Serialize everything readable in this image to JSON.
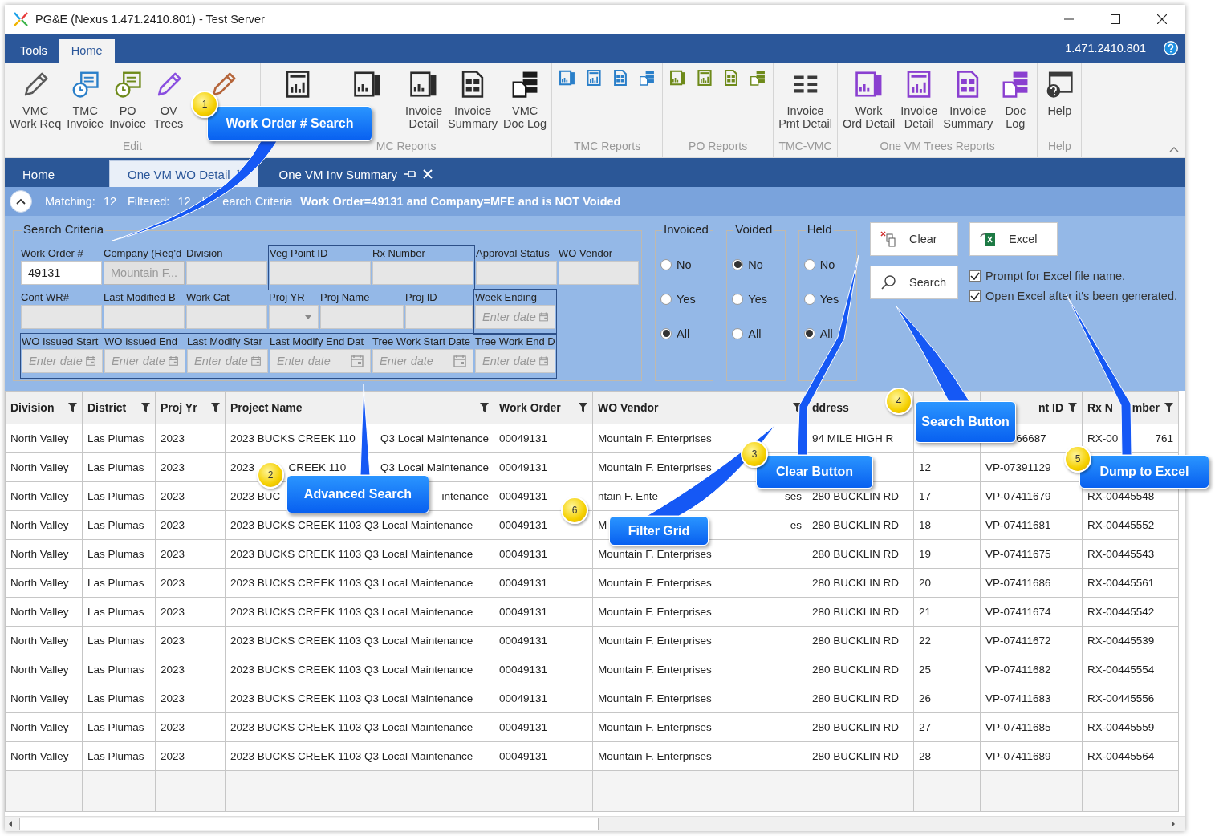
{
  "window": {
    "title": "PG&E (Nexus 1.471.2410.801) - Test Server"
  },
  "ribbon_tabs": [
    {
      "label": "Tools",
      "selected": false
    },
    {
      "label": "Home",
      "selected": true
    }
  ],
  "version": "1.471.2410.801",
  "ribbon_groups": [
    {
      "label": "Edit",
      "buttons": [
        {
          "kind": "pencil",
          "color": "#5a5a5a",
          "label": "VMC\nWork Req"
        },
        {
          "kind": "clock-doc",
          "color": "#2a7fc9",
          "label": "TMC\nInvoice"
        },
        {
          "kind": "clock-doc",
          "color": "#6e8a1a",
          "label": "PO\nInvoice"
        },
        {
          "kind": "pencil",
          "color": "#8a4fe0",
          "label": "OV\nTrees"
        },
        {
          "kind": "pencil",
          "color": "#b5653a"
        }
      ]
    },
    {
      "label": "MC Reports",
      "buttons": [
        {
          "kind": "report",
          "color": "#2b2b2b"
        },
        {
          "kind": "chart-doc",
          "color": "#2b2b2b"
        },
        {
          "kind": "chart-doc",
          "color": "#2b2b2b",
          "label": "Invoice\nDetail"
        },
        {
          "kind": "grid-doc",
          "color": "#2b2b2b",
          "label": "Invoice\nSummary"
        },
        {
          "kind": "doc-stack",
          "color": "#1a1a1a",
          "label": "VMC\nDoc Log"
        }
      ]
    },
    {
      "label": "TMC Reports",
      "buttons": [
        {
          "kind": "small-chart-doc",
          "color": "#2a7fc9"
        },
        {
          "kind": "small-report",
          "color": "#2a7fc9"
        },
        {
          "kind": "small-grid-doc",
          "color": "#2a7fc9"
        },
        {
          "kind": "small-doc-stack",
          "color": "#2a7fc9"
        }
      ]
    },
    {
      "label": "PO Reports",
      "buttons": [
        {
          "kind": "small-chart-doc",
          "color": "#6e8a1a"
        },
        {
          "kind": "small-report",
          "color": "#6e8a1a"
        },
        {
          "kind": "small-grid-doc",
          "color": "#6e8a1a"
        },
        {
          "kind": "small-doc-stack",
          "color": "#6e8a1a"
        }
      ]
    },
    {
      "label": "TMC-VMC",
      "buttons": [
        {
          "kind": "list",
          "color": "#3a3a3a",
          "label": "Invoice\nPmt Detail"
        }
      ]
    },
    {
      "label": "One VM Trees Reports",
      "buttons": [
        {
          "kind": "chart-doc",
          "color": "#8a3fd0",
          "label": "Work\nOrd Detail"
        },
        {
          "kind": "report",
          "color": "#8a3fd0",
          "label": "Invoice\nDetail"
        },
        {
          "kind": "grid-doc",
          "color": "#8a3fd0",
          "label": "Invoice\nSummary"
        },
        {
          "kind": "doc-stack",
          "color": "#8a3fd0",
          "label": "Doc\nLog"
        }
      ]
    },
    {
      "label": "Help",
      "buttons": [
        {
          "kind": "help",
          "color": "#3a3a3a",
          "label": "Help"
        }
      ]
    }
  ],
  "doc_tabs": [
    {
      "label": "Home",
      "selected": false,
      "pin": false,
      "closable": false
    },
    {
      "label": "One VM WO Detail",
      "selected": true,
      "pin": false,
      "closable": true
    },
    {
      "label": "One VM Inv Summary",
      "selected": false,
      "pin": true,
      "closable": true
    }
  ],
  "summary": {
    "matching_label": "Matching:",
    "matching": "12",
    "filtered_label": "Filtered:",
    "filtered": "12",
    "separator": "|",
    "criteria_label": "earch Criteria",
    "criteria": "Work Order=49131 and Company=MFE and is NOT Voided"
  },
  "search": {
    "title": "Search Criteria",
    "fields": [
      {
        "label": "Work Order #",
        "kind": "text",
        "value": "49131",
        "focused": true,
        "disabled": false
      },
      {
        "label": "Company (Req'd",
        "kind": "text",
        "value": "Mountain F...",
        "focused": false,
        "disabled": true
      },
      {
        "label": "Division",
        "kind": "text",
        "focused": false,
        "disabled": false
      },
      {
        "label": "Veg Point ID",
        "kind": "text",
        "focused": false,
        "disabled": false
      },
      {
        "label": "Rx Number",
        "kind": "text",
        "focused": false,
        "disabled": false
      },
      {
        "label": "Approval Status",
        "kind": "text",
        "focused": false,
        "disabled": false
      },
      {
        "label": "WO Vendor",
        "kind": "text",
        "focused": false,
        "disabled": false
      },
      {
        "label": "Cont WR#",
        "kind": "text",
        "focused": false,
        "disabled": false
      },
      {
        "label": "Last Modified B",
        "kind": "text",
        "focused": false,
        "disabled": false
      },
      {
        "label": "Work Cat",
        "kind": "text",
        "focused": false,
        "disabled": false
      },
      {
        "label": "Proj YR",
        "kind": "dropdown"
      },
      {
        "label": "Proj Name",
        "kind": "text",
        "focused": false,
        "disabled": false
      },
      {
        "label": "Proj ID",
        "kind": "text",
        "focused": false,
        "disabled": false
      },
      {
        "label": "Week Ending",
        "kind": "date",
        "placeholder": "Enter date"
      },
      {
        "label": "WO Issued Start",
        "kind": "date",
        "placeholder": "Enter date"
      },
      {
        "label": "WO Issued End",
        "kind": "date",
        "placeholder": "Enter date"
      },
      {
        "label": "Last Modify Star",
        "kind": "date",
        "placeholder": "Enter date"
      },
      {
        "label": "Last Modify End Dat",
        "kind": "date",
        "placeholder": "Enter date"
      },
      {
        "label": "Tree Work Start Date",
        "kind": "date",
        "placeholder": "Enter date"
      },
      {
        "label": "Tree Work End D",
        "kind": "date",
        "placeholder": "Enter date"
      }
    ],
    "radios": [
      {
        "title": "Invoiced",
        "options": [
          {
            "label": "No",
            "selected": false
          },
          {
            "label": "Yes",
            "selected": false
          },
          {
            "label": "All",
            "selected": true
          }
        ]
      },
      {
        "title": "Voided",
        "options": [
          {
            "label": "No",
            "selected": true
          },
          {
            "label": "Yes",
            "selected": false
          },
          {
            "label": "All",
            "selected": false
          }
        ]
      },
      {
        "title": "Held",
        "options": [
          {
            "label": "No",
            "selected": false
          },
          {
            "label": "Yes",
            "selected": false
          },
          {
            "label": "All",
            "selected": true
          }
        ]
      }
    ],
    "buttons": [
      {
        "kind": "clear",
        "label": "Clear"
      },
      {
        "kind": "excel",
        "label": "Excel"
      },
      {
        "kind": "search",
        "label": "Search"
      }
    ],
    "options": [
      {
        "label": "Prompt for Excel file name.",
        "checked": true
      },
      {
        "label": "Open Excel after it's been generated.",
        "checked": true
      }
    ]
  },
  "grid": {
    "columns": [
      {
        "header": "Division",
        "filter": true
      },
      {
        "header": "District",
        "filter": true
      },
      {
        "header": "Proj Yr",
        "filter": true
      },
      {
        "header": "Project Name",
        "filter": true
      },
      {
        "header": "Work Order",
        "filter": true
      },
      {
        "header": "WO Vendor",
        "filter": true
      },
      {
        "header": "ddress"
      },
      {},
      {
        "header": [
          "nt ID"
        ],
        "filter": true
      },
      {
        "header": [
          "Rx N",
          "mber"
        ],
        "filter": true
      }
    ],
    "rows": [
      [
        "North Valley",
        "Las Plumas",
        "2023",
        [
          "2023 BUCKS CREEK 110",
          "Q3 Local Maintenance"
        ],
        "00049131",
        "Mountain F. Enterprises",
        "94 MILE HIGH R",
        "",
        [
          "66687"
        ],
        [
          "RX-00",
          "761"
        ]
      ],
      [
        "North Valley",
        "Las Plumas",
        "2023",
        [
          "2023",
          "CREEK 110",
          "Q3 Local Maintenance"
        ],
        "00049131",
        "Mountain F. Enterprises",
        "",
        "12",
        "VP-07391129",
        ""
      ],
      [
        "North Valley",
        "Las Plumas",
        "2023",
        [
          "2023 BUC",
          "intenance"
        ],
        "00049131",
        [
          "ntain F. Ente",
          "ses"
        ],
        "280 BUCKLIN RD",
        "17",
        "VP-07411679",
        "RX-00445548"
      ],
      [
        "North Valley",
        "Las Plumas",
        "2023",
        "2023 BUCKS CREEK 1103 Q3 Local Maintenance",
        "00049131",
        [
          "M",
          "es"
        ],
        "280 BUCKLIN RD",
        "18",
        "VP-07411681",
        "RX-00445552"
      ],
      [
        "North Valley",
        "Las Plumas",
        "2023",
        "2023 BUCKS CREEK 1103 Q3 Local Maintenance",
        "00049131",
        "Mountain F. Enterprises",
        "280 BUCKLIN RD",
        "19",
        "VP-07411675",
        "RX-00445543"
      ],
      [
        "North Valley",
        "Las Plumas",
        "2023",
        "2023 BUCKS CREEK 1103 Q3 Local Maintenance",
        "00049131",
        "Mountain F. Enterprises",
        "280 BUCKLIN RD",
        "20",
        "VP-07411686",
        "RX-00445561"
      ],
      [
        "North Valley",
        "Las Plumas",
        "2023",
        "2023 BUCKS CREEK 1103 Q3 Local Maintenance",
        "00049131",
        "Mountain F. Enterprises",
        "280 BUCKLIN RD",
        "21",
        "VP-07411674",
        "RX-00445542"
      ],
      [
        "North Valley",
        "Las Plumas",
        "2023",
        "2023 BUCKS CREEK 1103 Q3 Local Maintenance",
        "00049131",
        "Mountain F. Enterprises",
        "280 BUCKLIN RD",
        "22",
        "VP-07411672",
        "RX-00445539"
      ],
      [
        "North Valley",
        "Las Plumas",
        "2023",
        "2023 BUCKS CREEK 1103 Q3 Local Maintenance",
        "00049131",
        "Mountain F. Enterprises",
        "280 BUCKLIN RD",
        "25",
        "VP-07411682",
        "RX-00445554"
      ],
      [
        "North Valley",
        "Las Plumas",
        "2023",
        "2023 BUCKS CREEK 1103 Q3 Local Maintenance",
        "00049131",
        "Mountain F. Enterprises",
        "280 BUCKLIN RD",
        "26",
        "VP-07411683",
        "RX-00445556"
      ],
      [
        "North Valley",
        "Las Plumas",
        "2023",
        "2023 BUCKS CREEK 1103 Q3 Local Maintenance",
        "00049131",
        "Mountain F. Enterprises",
        "280 BUCKLIN RD",
        "27",
        "VP-07411685",
        "RX-00445559"
      ],
      [
        "North Valley",
        "Las Plumas",
        "2023",
        "2023 BUCKS CREEK 1103 Q3 Local Maintenance",
        "00049131",
        "Mountain F. Enterprises",
        "280 BUCKLIN RD",
        "28",
        "VP-07411689",
        "RX-00445564"
      ]
    ]
  },
  "callouts": [
    {
      "badge": "1",
      "text": "Work Order # Search"
    },
    {
      "badge": "2",
      "text": "Advanced Search"
    },
    {
      "badge": "3",
      "text": "Clear Button"
    },
    {
      "badge": "4",
      "text": "Search Button"
    },
    {
      "badge": "5",
      "text": "Dump to Excel"
    },
    {
      "badge": "6",
      "text": "Filter Grid"
    }
  ]
}
